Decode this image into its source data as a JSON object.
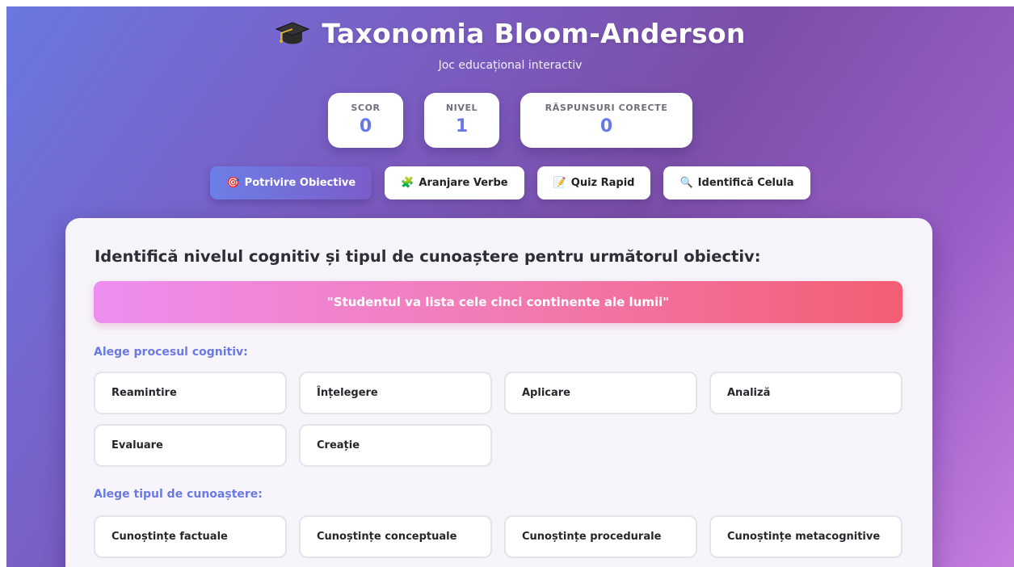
{
  "header": {
    "title": "Taxonomia Bloom-Anderson",
    "subtitle": "Joc educațional interactiv"
  },
  "stats": [
    {
      "label": "SCOR",
      "value": "0"
    },
    {
      "label": "NIVEL",
      "value": "1"
    },
    {
      "label": "RĂSPUNSURI CORECTE",
      "value": "0"
    }
  ],
  "tabs": [
    {
      "icon": "🎯",
      "label": "Potrivire Obiective",
      "active": true
    },
    {
      "icon": "🧩",
      "label": "Aranjare Verbe",
      "active": false
    },
    {
      "icon": "📝",
      "label": "Quiz Rapid",
      "active": false
    },
    {
      "icon": "🔍",
      "label": "Identifică Celula",
      "active": false
    }
  ],
  "game": {
    "question": "Identifică nivelul cognitiv și tipul de cunoaștere pentru următorul obiectiv:",
    "objective": "\"Studentul va lista cele cinci continente ale lumii\"",
    "process_label": "Alege procesul cognitiv:",
    "process_options": [
      "Reamintire",
      "Înțelegere",
      "Aplicare",
      "Analiză",
      "Evaluare",
      "Creație"
    ],
    "knowledge_label": "Alege tipul de cunoaștere:",
    "knowledge_options": [
      "Cunoștințe factuale",
      "Cunoștințe conceptuale",
      "Cunoștințe procedurale",
      "Cunoștințe metacognitive"
    ]
  },
  "colors": {
    "accent": "#6a7ae2",
    "objective_gradient": [
      "#ee8ef0",
      "#f35d72"
    ]
  }
}
